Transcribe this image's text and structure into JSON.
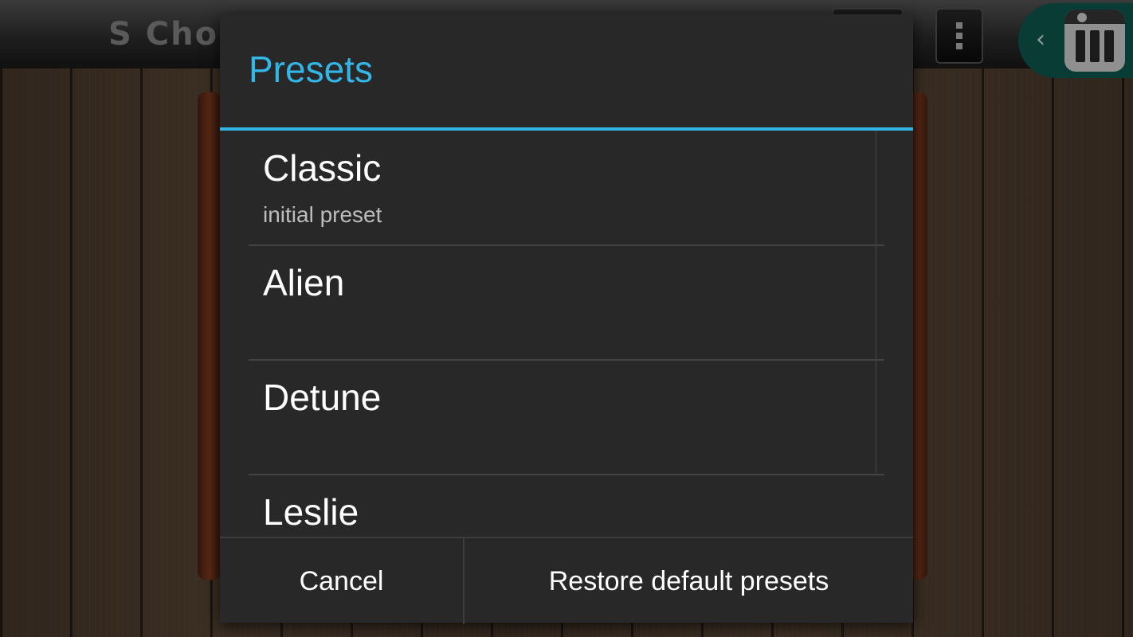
{
  "background_app": {
    "title": "S Cho",
    "menu_icon": "overflow-menu-icon",
    "side_tab_icon": "piano-keys-icon"
  },
  "dialog": {
    "title": "Presets",
    "items": [
      {
        "name": "Classic",
        "subtitle": "initial preset"
      },
      {
        "name": "Alien",
        "subtitle": ""
      },
      {
        "name": "Detune",
        "subtitle": ""
      },
      {
        "name": "Leslie",
        "subtitle": ""
      }
    ],
    "buttons": {
      "cancel": "Cancel",
      "restore": "Restore default presets"
    }
  },
  "colors": {
    "accent": "#33b5e5",
    "dialog_bg": "#282828",
    "side_tab": "#0e5c52"
  }
}
